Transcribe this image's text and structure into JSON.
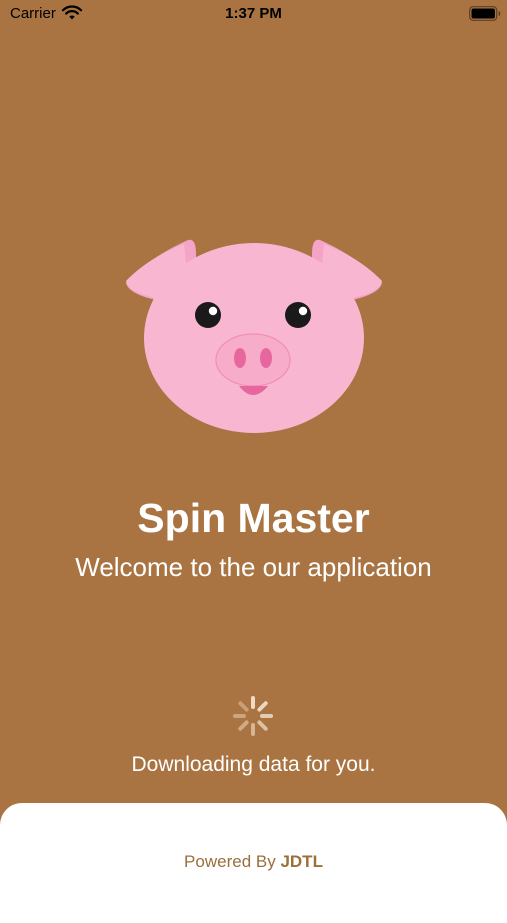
{
  "status_bar": {
    "carrier": "Carrier",
    "time": "1:37 PM",
    "wifi_icon": "wifi-icon",
    "battery_icon": "battery-icon"
  },
  "splash": {
    "logo_icon": "pig-face-icon",
    "title": "Spin Master",
    "subtitle": "Welcome to the our application",
    "spinner_icon": "activity-spinner-icon",
    "status": "Downloading data for you."
  },
  "footer": {
    "prefix": "Powered By",
    "brand": "JDTL"
  },
  "colors": {
    "background": "#a97442",
    "pig_pink": "#f9b6d1",
    "footer_text": "#9a6f3c",
    "card": "#ffffff"
  }
}
